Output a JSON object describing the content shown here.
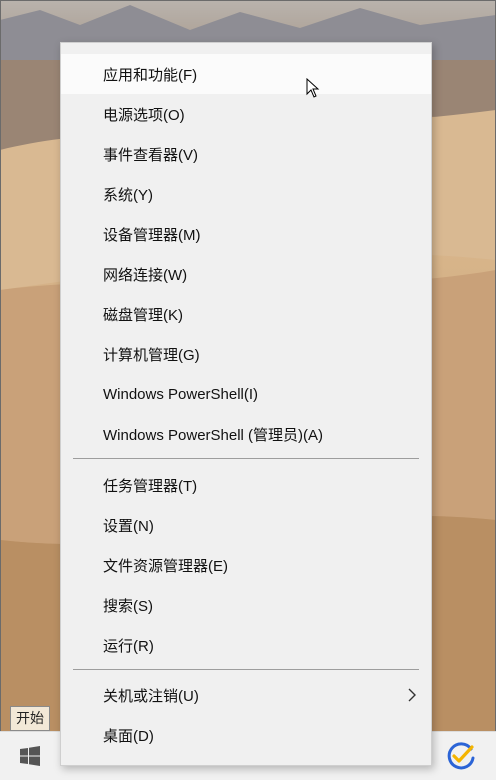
{
  "menu": {
    "items": [
      {
        "label": "应用和功能(F)"
      },
      {
        "label": "电源选项(O)"
      },
      {
        "label": "事件查看器(V)"
      },
      {
        "label": "系统(Y)"
      },
      {
        "label": "设备管理器(M)"
      },
      {
        "label": "网络连接(W)"
      },
      {
        "label": "磁盘管理(K)"
      },
      {
        "label": "计算机管理(G)"
      },
      {
        "label": "Windows PowerShell(I)"
      },
      {
        "label": "Windows PowerShell (管理员)(A)"
      },
      {
        "label": "任务管理器(T)"
      },
      {
        "label": "设置(N)"
      },
      {
        "label": "文件资源管理器(E)"
      },
      {
        "label": "搜索(S)"
      },
      {
        "label": "运行(R)"
      },
      {
        "label": "关机或注销(U)"
      },
      {
        "label": "桌面(D)"
      }
    ]
  },
  "tooltip": {
    "text": "开始"
  },
  "icons": {
    "start": "windows-logo-icon",
    "submenu": "chevron-right-icon",
    "tray": "checkmark-app-icon",
    "cursor": "mouse-pointer-icon"
  },
  "colors": {
    "menu_bg": "#f0f0f0",
    "hover_bg": "#fbfbfb",
    "start_blue": "#1f6fc5",
    "tray_blue": "#2b64d6",
    "tray_yellow": "#f4b400"
  }
}
